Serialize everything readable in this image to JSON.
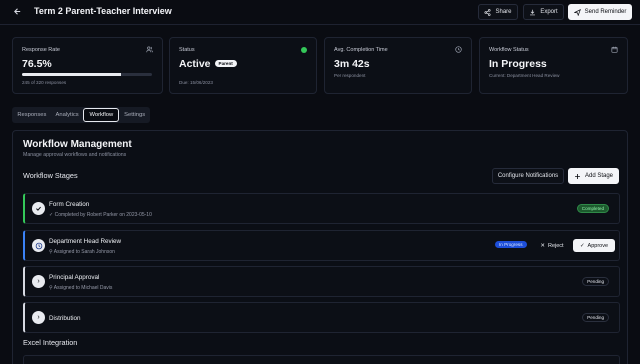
{
  "header": {
    "title": "Term 2 Parent-Teacher Interview",
    "share_label": "Share",
    "export_label": "Export",
    "send_label": "Send Reminder"
  },
  "stats": {
    "response_rate": {
      "label": "Response Rate",
      "value": "76.5%",
      "progress": 0.765,
      "sub": "245 of 320 responses"
    },
    "status": {
      "label": "Status",
      "value": "Active",
      "pill": "Parent",
      "sub": "Due: 15/06/2023",
      "dot_color": "#34c759"
    },
    "avg_time": {
      "label": "Avg. Completion Time",
      "value": "3m 42s",
      "sub": "Per respondent"
    },
    "workflow": {
      "label": "Workflow Status",
      "value": "In Progress",
      "sub": "Current: Department Head Review"
    }
  },
  "tabs": [
    "Responses",
    "Analytics",
    "Workflow",
    "Settings"
  ],
  "active_tab": "Workflow",
  "panel": {
    "title": "Workflow Management",
    "subtitle": "Manage approval workflows and notifications",
    "stages_heading": "Workflow Stages",
    "configure_label": "Configure Notifications",
    "add_stage_label": "Add Stage",
    "excel_heading": "Excel Integration"
  },
  "stages": [
    {
      "name": "Form Creation",
      "detail": "✓ Completed by Robert Parker on 2023-05-10",
      "badge": "Completed",
      "icon": "check-icon",
      "accent": "#34c759"
    },
    {
      "name": "Department Head Review",
      "detail": "Assigned to Sarah Johnson",
      "badge": "In Progress",
      "icon": "clock-icon",
      "accent": "#3b82f6",
      "reject_label": "Reject",
      "approve_label": "Approve"
    },
    {
      "name": "Principal Approval",
      "detail": "Assigned to Michael Davis",
      "badge": "Pending",
      "icon": "chevron-right-icon",
      "accent": "#d6d9e2"
    },
    {
      "name": "Distribution",
      "detail": "",
      "badge": "Pending",
      "icon": "chevron-right-icon",
      "accent": "#d6d9e2"
    }
  ],
  "colors": {
    "background": "#0a0c12",
    "completed": "#34c759",
    "in_progress": "#3b82f6"
  }
}
